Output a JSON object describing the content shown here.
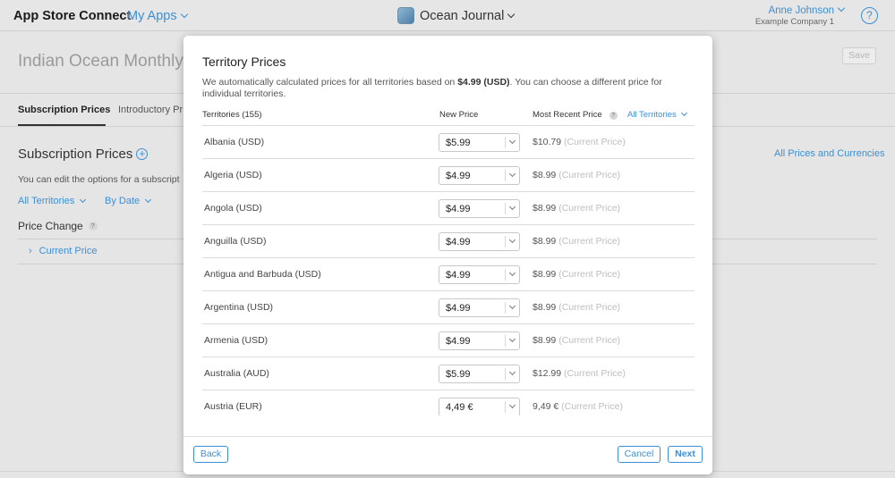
{
  "header": {
    "brand": "App Store Connect",
    "my_apps": "My Apps",
    "app_name": "Ocean Journal",
    "user_name": "Anne Johnson",
    "company": "Example Company 1",
    "help": "?"
  },
  "page": {
    "title": "Indian Ocean Monthly",
    "save_label": "Save",
    "tabs": [
      "Subscription Prices",
      "Introductory Pr"
    ],
    "section_title": "Subscription Prices",
    "section_desc": "You can edit the options for a subscript",
    "filter_territories": "All Territories",
    "filter_date": "By Date",
    "price_change": "Price Change",
    "current_price_link": "Current Price",
    "all_prices_link": "All Prices and Currencies"
  },
  "modal": {
    "title": "Territory Prices",
    "desc_prefix": "We automatically calculated prices for all territories based on ",
    "desc_price": "$4.99 (USD)",
    "desc_suffix": ". You can choose a different price for individual territories.",
    "col_territories": "Territories (155)",
    "col_new_price": "New Price",
    "col_recent": "Most Recent Price",
    "col_filter": "All Territories",
    "rows": [
      {
        "territory": "Albania (USD)",
        "new_price": "$5.99",
        "recent": "$10.79",
        "note": "(Current Price)"
      },
      {
        "territory": "Algeria (USD)",
        "new_price": "$4.99",
        "recent": "$8.99",
        "note": "(Current Price)"
      },
      {
        "territory": "Angola (USD)",
        "new_price": "$4.99",
        "recent": "$8.99",
        "note": "(Current Price)"
      },
      {
        "territory": "Anguilla (USD)",
        "new_price": "$4.99",
        "recent": "$8.99",
        "note": "(Current Price)"
      },
      {
        "territory": "Antigua and Barbuda (USD)",
        "new_price": "$4.99",
        "recent": "$8.99",
        "note": "(Current Price)"
      },
      {
        "territory": "Argentina (USD)",
        "new_price": "$4.99",
        "recent": "$8.99",
        "note": "(Current Price)"
      },
      {
        "territory": "Armenia (USD)",
        "new_price": "$4.99",
        "recent": "$8.99",
        "note": "(Current Price)"
      },
      {
        "territory": "Australia (AUD)",
        "new_price": "$5.99",
        "recent": "$12.99",
        "note": "(Current Price)"
      },
      {
        "territory": "Austria (EUR)",
        "new_price": "4,49 €",
        "recent": "9,49 €",
        "note": "(Current Price)"
      }
    ],
    "back_label": "Back",
    "cancel_label": "Cancel",
    "next_label": "Next"
  },
  "colors": {
    "accent": "#3b8fd6",
    "muted_note": "#bdbdbd"
  }
}
